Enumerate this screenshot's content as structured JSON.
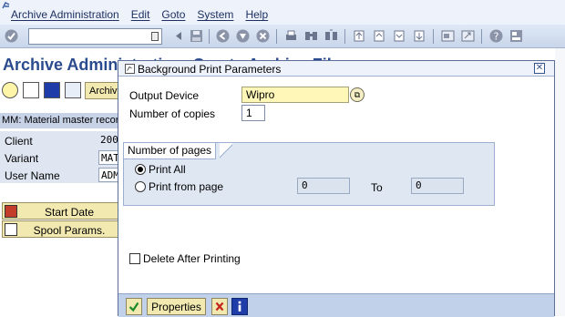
{
  "menubar": {
    "items": [
      "Archive Administration",
      "Edit",
      "Goto",
      "System",
      "Help"
    ]
  },
  "toolbar": {
    "command_field_value": "",
    "icons": [
      "enter-icon",
      "save-icon",
      "back-icon",
      "exit-icon",
      "cancel-icon",
      "print-icon",
      "find-icon",
      "find-next-icon",
      "first-page-icon",
      "previous-page-icon",
      "next-page-icon",
      "last-page-icon",
      "create-session-icon",
      "shortcut-icon",
      "help-icon",
      "layout-icon"
    ]
  },
  "background": {
    "title": "Archive Administration: Create Archive Files",
    "archive_button": "Archive",
    "section_header": "MM: Material master record",
    "rows": [
      {
        "label": "Client",
        "value": "200"
      },
      {
        "label": "Variant",
        "value": "MAT"
      },
      {
        "label": "User Name",
        "value": "ADM"
      }
    ],
    "start_date_button": "Start Date",
    "spool_params_button": "Spool Params."
  },
  "dialog": {
    "title": "Background Print Parameters",
    "output_device_label": "Output Device",
    "output_device_value": "Wipro",
    "copies_label": "Number of copies",
    "copies_value": "1",
    "pages_group_title": "Number of pages",
    "print_all_label": "Print All",
    "print_all_selected": true,
    "print_from_label": "Print from page",
    "from_value": "0",
    "to_label": "To",
    "to_value": "0",
    "delete_after_label": "Delete After Printing",
    "delete_after_checked": false,
    "properties_button": "Properties"
  },
  "colors": {
    "title_blue": "#2a4b8d",
    "dialog_footer": "#c2d1ea",
    "button_yellow": "#f2e9b0",
    "input_yellow": "#fff7b8"
  }
}
